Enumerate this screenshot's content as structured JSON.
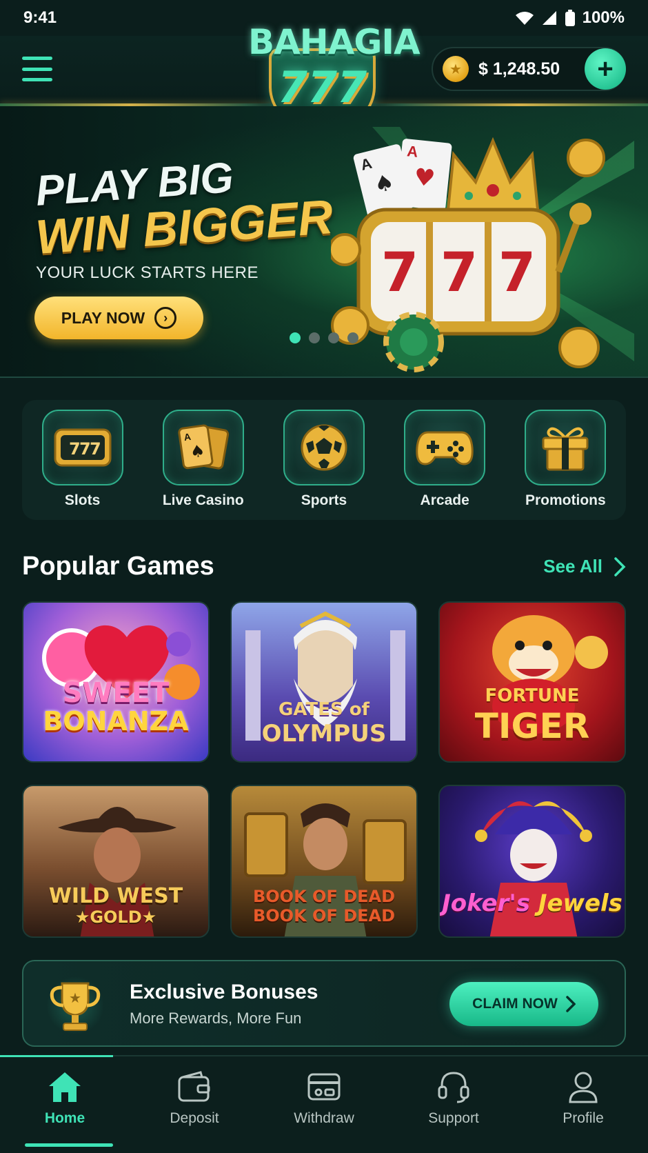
{
  "status_bar": {
    "time": "9:41",
    "battery": "100%"
  },
  "header": {
    "logo_title": "BAHAGIA",
    "logo_number": "777",
    "balance": "$ 1,248.50",
    "add_label": "+"
  },
  "hero": {
    "line1": "PLAY BIG",
    "line2": "WIN BIGGER",
    "subtitle": "YOUR LUCK STARTS HERE",
    "cta_label": "PLAY NOW",
    "reel_symbols": [
      "7",
      "7",
      "7"
    ],
    "slide_count": 4,
    "active_slide": 1
  },
  "categories": [
    {
      "label": "Slots",
      "icon": "slot-machine-icon"
    },
    {
      "label": "Live Casino",
      "icon": "playing-cards-icon"
    },
    {
      "label": "Sports",
      "icon": "soccer-ball-icon"
    },
    {
      "label": "Arcade",
      "icon": "gamepad-icon"
    },
    {
      "label": "Promotions",
      "icon": "gift-icon"
    }
  ],
  "popular": {
    "title": "Popular Games",
    "see_all": "See All",
    "games": [
      {
        "line1": "SWEET",
        "line2": "BONANZA"
      },
      {
        "line1": "GATES of",
        "line2": "OLYMPUS"
      },
      {
        "line1": "FORTUNE",
        "line2": "TIGER"
      },
      {
        "line1": "WILD WEST",
        "line2": "★GOLD★"
      },
      {
        "line1": "BOOK OF DEAD",
        "line2": "BOOK OF DEAD"
      },
      {
        "line1": "Joker's",
        "line2": "Jewels"
      }
    ]
  },
  "bonus": {
    "title": "Exclusive Bonuses",
    "subtitle": "More Rewards, More Fun",
    "cta_label": "CLAIM NOW"
  },
  "bottom_nav": [
    {
      "label": "Home",
      "icon": "home-icon",
      "active": true
    },
    {
      "label": "Deposit",
      "icon": "wallet-icon",
      "active": false
    },
    {
      "label": "Withdraw",
      "icon": "card-icon",
      "active": false
    },
    {
      "label": "Support",
      "icon": "headset-icon",
      "active": false
    },
    {
      "label": "Profile",
      "icon": "user-icon",
      "active": false
    }
  ],
  "colors": {
    "background": "#0b1e1c",
    "accent": "#3fe3b6",
    "gold": "#f4c64c"
  }
}
